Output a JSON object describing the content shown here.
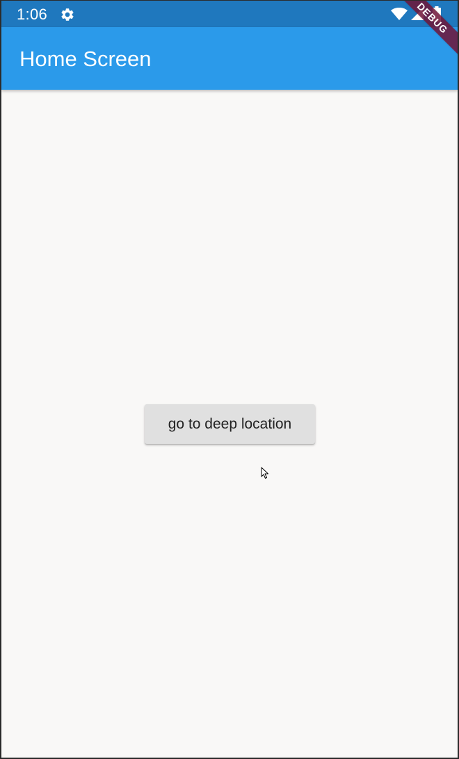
{
  "status_bar": {
    "time": "1:06",
    "icons": [
      "gear-icon",
      "wifi-icon",
      "cell-signal-icon",
      "battery-icon"
    ],
    "background_color": "#1f78be"
  },
  "app_bar": {
    "title": "Home Screen",
    "background_color": "#2b9aea"
  },
  "main": {
    "button_label": "go to deep location",
    "background_color": "#f9f8f7"
  },
  "debug_banner": {
    "label": "DEBUG",
    "color": "#701437"
  }
}
